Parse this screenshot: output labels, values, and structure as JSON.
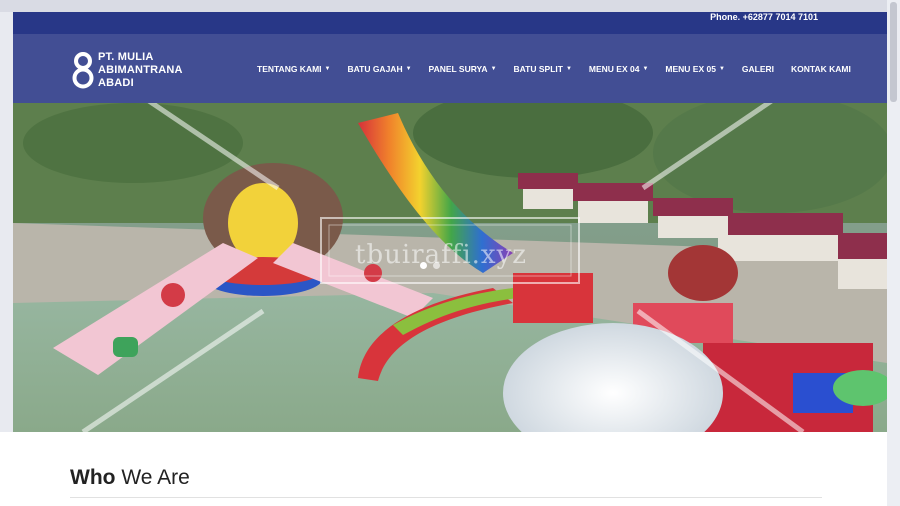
{
  "header": {
    "phone": "Phone. +62877 7014 7101",
    "logo": {
      "line1": "PT. MULIA",
      "line2": "ABIMANTRANA",
      "line3": "ABADI"
    }
  },
  "nav": {
    "items": [
      {
        "label": "TENTANG KAMI",
        "has_dropdown": true
      },
      {
        "label": "BATU GAJAH",
        "has_dropdown": true
      },
      {
        "label": "PANEL SURYA",
        "has_dropdown": true
      },
      {
        "label": "BATU SPLIT",
        "has_dropdown": true
      },
      {
        "label": "MENU EX 04",
        "has_dropdown": true
      },
      {
        "label": "MENU EX 05",
        "has_dropdown": true
      },
      {
        "label": "GALERI",
        "has_dropdown": false
      },
      {
        "label": "KONTAK KAMI",
        "has_dropdown": false
      }
    ],
    "caret": "▼"
  },
  "hero": {
    "watermark": "tbuiraffi.xyz",
    "slides_total": 2,
    "active_slide": 1
  },
  "section": {
    "title_bold": "Who",
    "title_rest": " We Are"
  },
  "colors": {
    "nav_bg": "#34418c",
    "phone_bar_bg": "#283787",
    "text_light": "#ffffff"
  }
}
